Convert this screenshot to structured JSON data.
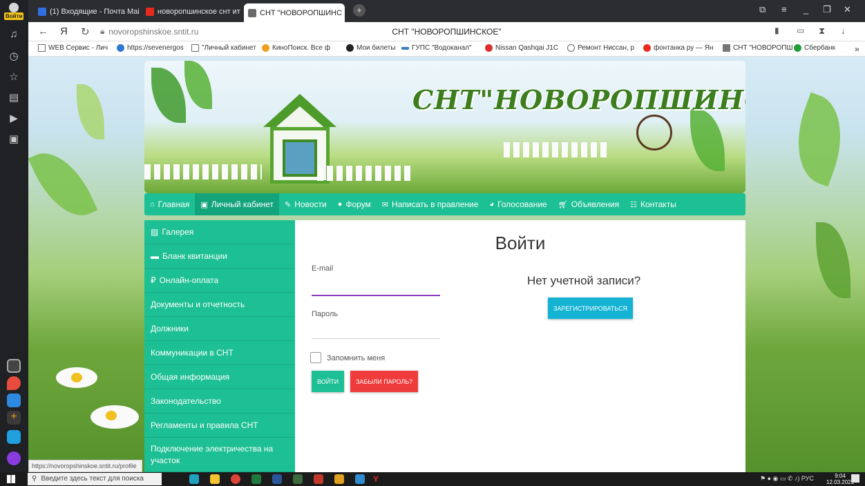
{
  "browser": {
    "tabs": [
      {
        "label": "(1) Входящие - Почта Mai"
      },
      {
        "label": "новоропшинское снт ит"
      },
      {
        "label": "СНТ \"НОВОРОПШИНС"
      }
    ],
    "address": "novoropshinskoe.sntit.ru",
    "page_title": "СНТ \"НОВОРОПШИНСКОЕ\"",
    "sidebar_badge": "Войти",
    "bookmarks": [
      "WEB Сервис - Лич",
      "https://sevenergos",
      "\"Личный кабинет",
      "КиноПоиск. Все ф",
      "Мои билеты",
      "ГУПС \"Водоканал\"",
      "Nissan Qashqai J1С",
      "Ремонт Ниссан, р",
      "фонтанка ру — Ян",
      "СНТ \"НОВОРОПШ",
      "Сбербанк"
    ],
    "status_url": "https://novoropshinskoe.sntit.ru/profile"
  },
  "site": {
    "title": "СНТ\"НОВОРОПШИНСКОЕ\"",
    "nav": [
      {
        "label": "Главная",
        "icon": "home-icon"
      },
      {
        "label": "Личный кабинет",
        "icon": "id-card-icon"
      },
      {
        "label": "Новости",
        "icon": "edit-icon"
      },
      {
        "label": "Форум",
        "icon": "comments-icon"
      },
      {
        "label": "Написать в правление",
        "icon": "envelope-icon"
      },
      {
        "label": "Голосование",
        "icon": "pie-chart-icon"
      },
      {
        "label": "Объявления",
        "icon": "cart-icon"
      },
      {
        "label": "Контакты",
        "icon": "signpost-icon"
      }
    ],
    "side_menu": [
      {
        "label": "Галерея",
        "icon": "image-icon"
      },
      {
        "label": "Бланк квитанции",
        "icon": "card-icon"
      },
      {
        "label": "Онлайн-оплата",
        "icon": "ruble-icon"
      },
      {
        "label": "Документы и отчетность"
      },
      {
        "label": "Должники"
      },
      {
        "label": "Коммуникации в СНТ"
      },
      {
        "label": "Общая информация"
      },
      {
        "label": "Законодательство"
      },
      {
        "label": "Регламенты и правила СНТ"
      },
      {
        "label": "Подключение электричества на участок"
      }
    ]
  },
  "login": {
    "title": "Войти",
    "email_label": "E-mail",
    "email_value": "",
    "password_label": "Пароль",
    "password_value": "",
    "remember_label": "Запомнить меня",
    "login_button": "ВОЙТИ",
    "forgot_button": "ЗАБЫЛИ ПАРОЛЬ?",
    "no_account": "Нет учетной записи?",
    "register_button": "ЗАРЕГИСТРИРОВАТЬСЯ"
  },
  "taskbar": {
    "search_placeholder": "Введите здесь текст для поиска",
    "language": "РУС",
    "time": "9:04",
    "date": "12.03.2021"
  },
  "colors": {
    "accent_green": "#1dbf94",
    "active_green": "#13a47c",
    "login_button": "#1dbf94",
    "forgot_button": "#ef3b3b",
    "register_button": "#14b3d4",
    "email_focus": "#8e3bc2"
  }
}
